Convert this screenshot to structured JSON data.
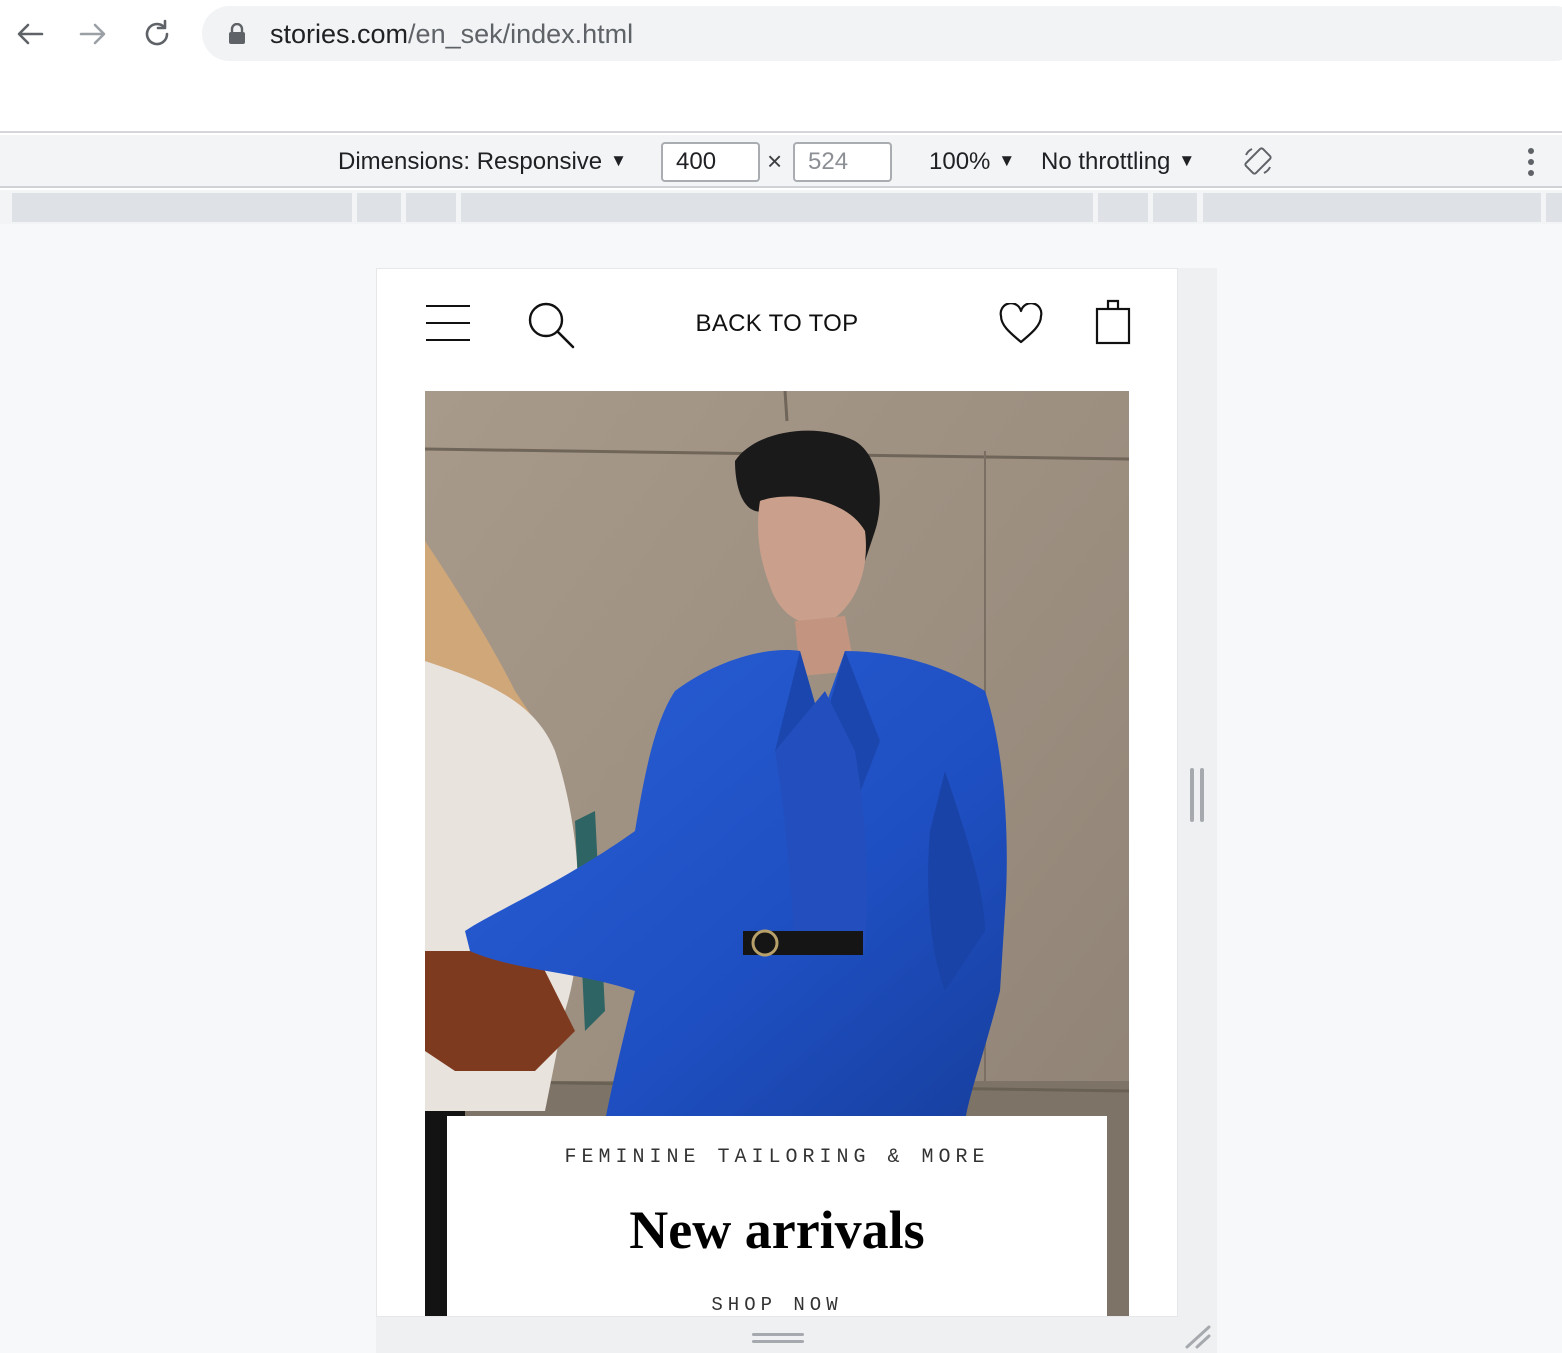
{
  "browser": {
    "url_host": "stories.com",
    "url_path": "/en_sek/index.html"
  },
  "device_toolbar": {
    "dimensions_label": "Dimensions: Responsive",
    "width_value": "400",
    "height_placeholder": "524",
    "times_symbol": "×",
    "zoom_label": "100%",
    "throttling_label": "No throttling"
  },
  "site": {
    "back_to_top_label": "BACK TO TOP",
    "hero": {
      "kicker": "FEMININE TAILORING & MORE",
      "headline": "New arrivals",
      "cta_label": "SHOP NOW"
    }
  },
  "icons": {
    "back": "arrow-left-icon",
    "forward": "arrow-right-icon",
    "reload": "reload-icon",
    "lock": "lock-icon",
    "rotate": "rotate-device-icon",
    "more": "more-vertical-icon",
    "menu": "hamburger-menu-icon",
    "search": "search-icon",
    "wishlist": "heart-icon",
    "bag": "shopping-bag-icon"
  },
  "colors": {
    "jacket_blue": "#1e4fc2",
    "omnibox_bg": "#f1f3f4",
    "toolbar_bg": "#f3f4f6"
  }
}
